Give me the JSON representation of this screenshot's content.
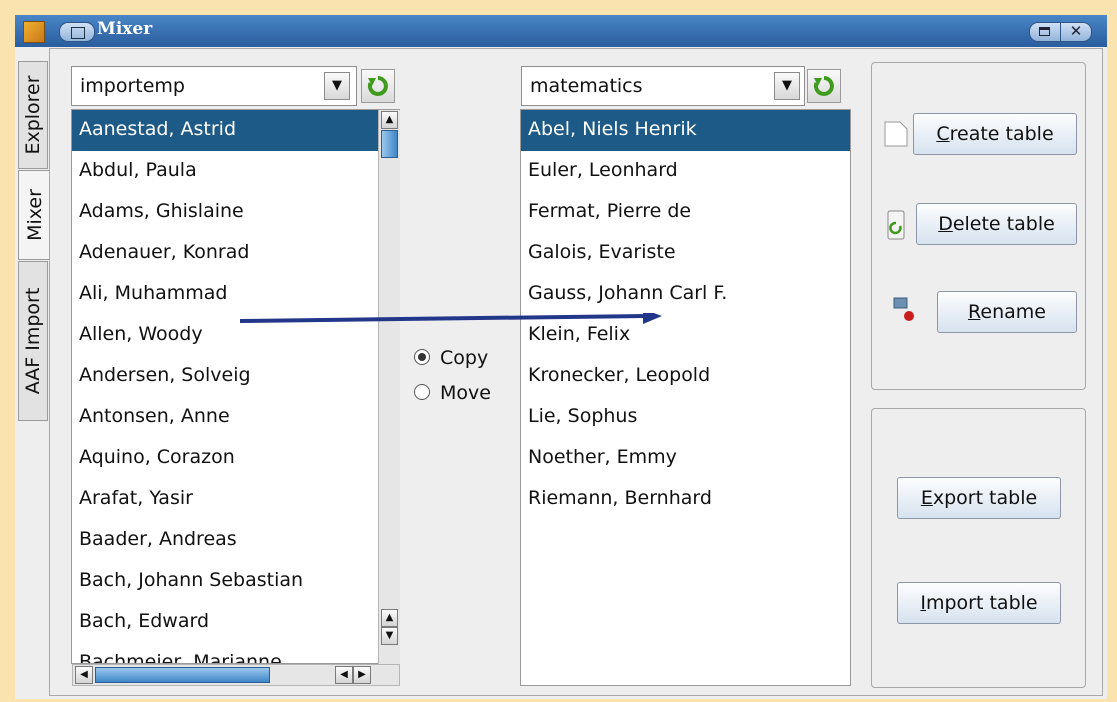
{
  "window": {
    "title": "Mixer"
  },
  "tabs": [
    "Explorer",
    "Mixer",
    "AAF Import"
  ],
  "left_panel": {
    "table_selector": "importemp",
    "items": [
      "Aanestad, Astrid",
      "Abdul, Paula",
      "Adams, Ghislaine",
      "Adenauer, Konrad",
      "Ali, Muhammad",
      "Allen, Woody",
      "Andersen, Solveig",
      "Antonsen, Anne",
      "Aquino, Corazon",
      "Arafat, Yasir",
      "Baader, Andreas",
      "Bach, Johann Sebastian",
      "Bach, Edward",
      "Bachmeier, Marianne"
    ],
    "selected_index": 0
  },
  "transfer_mode": {
    "options": [
      "Copy",
      "Move"
    ],
    "selected": "Copy"
  },
  "right_panel": {
    "table_selector": "matematics",
    "items": [
      "Abel, Niels Henrik",
      "Euler, Leonhard",
      "Fermat, Pierre de",
      "Galois, Evariste",
      "Gauss, Johann Carl F.",
      "Klein, Felix",
      "Kronecker, Leopold",
      "Lie, Sophus",
      "Noether, Emmy",
      "Riemann, Bernhard"
    ],
    "selected_index": 0
  },
  "table_actions": {
    "create": {
      "mnemonic": "C",
      "rest": "reate table"
    },
    "delete": {
      "mnemonic": "D",
      "rest": "elete table"
    },
    "rename": {
      "mnemonic": "R",
      "rest": "ename"
    }
  },
  "io_actions": {
    "export": {
      "mnemonic": "E",
      "rest": "xport table"
    },
    "import": {
      "mnemonic": "I",
      "rest": "mport table"
    }
  },
  "colors": {
    "selection": "#1e5a87",
    "titlebar": "#2a5d9e",
    "annotation_arrow": "#23378a"
  }
}
